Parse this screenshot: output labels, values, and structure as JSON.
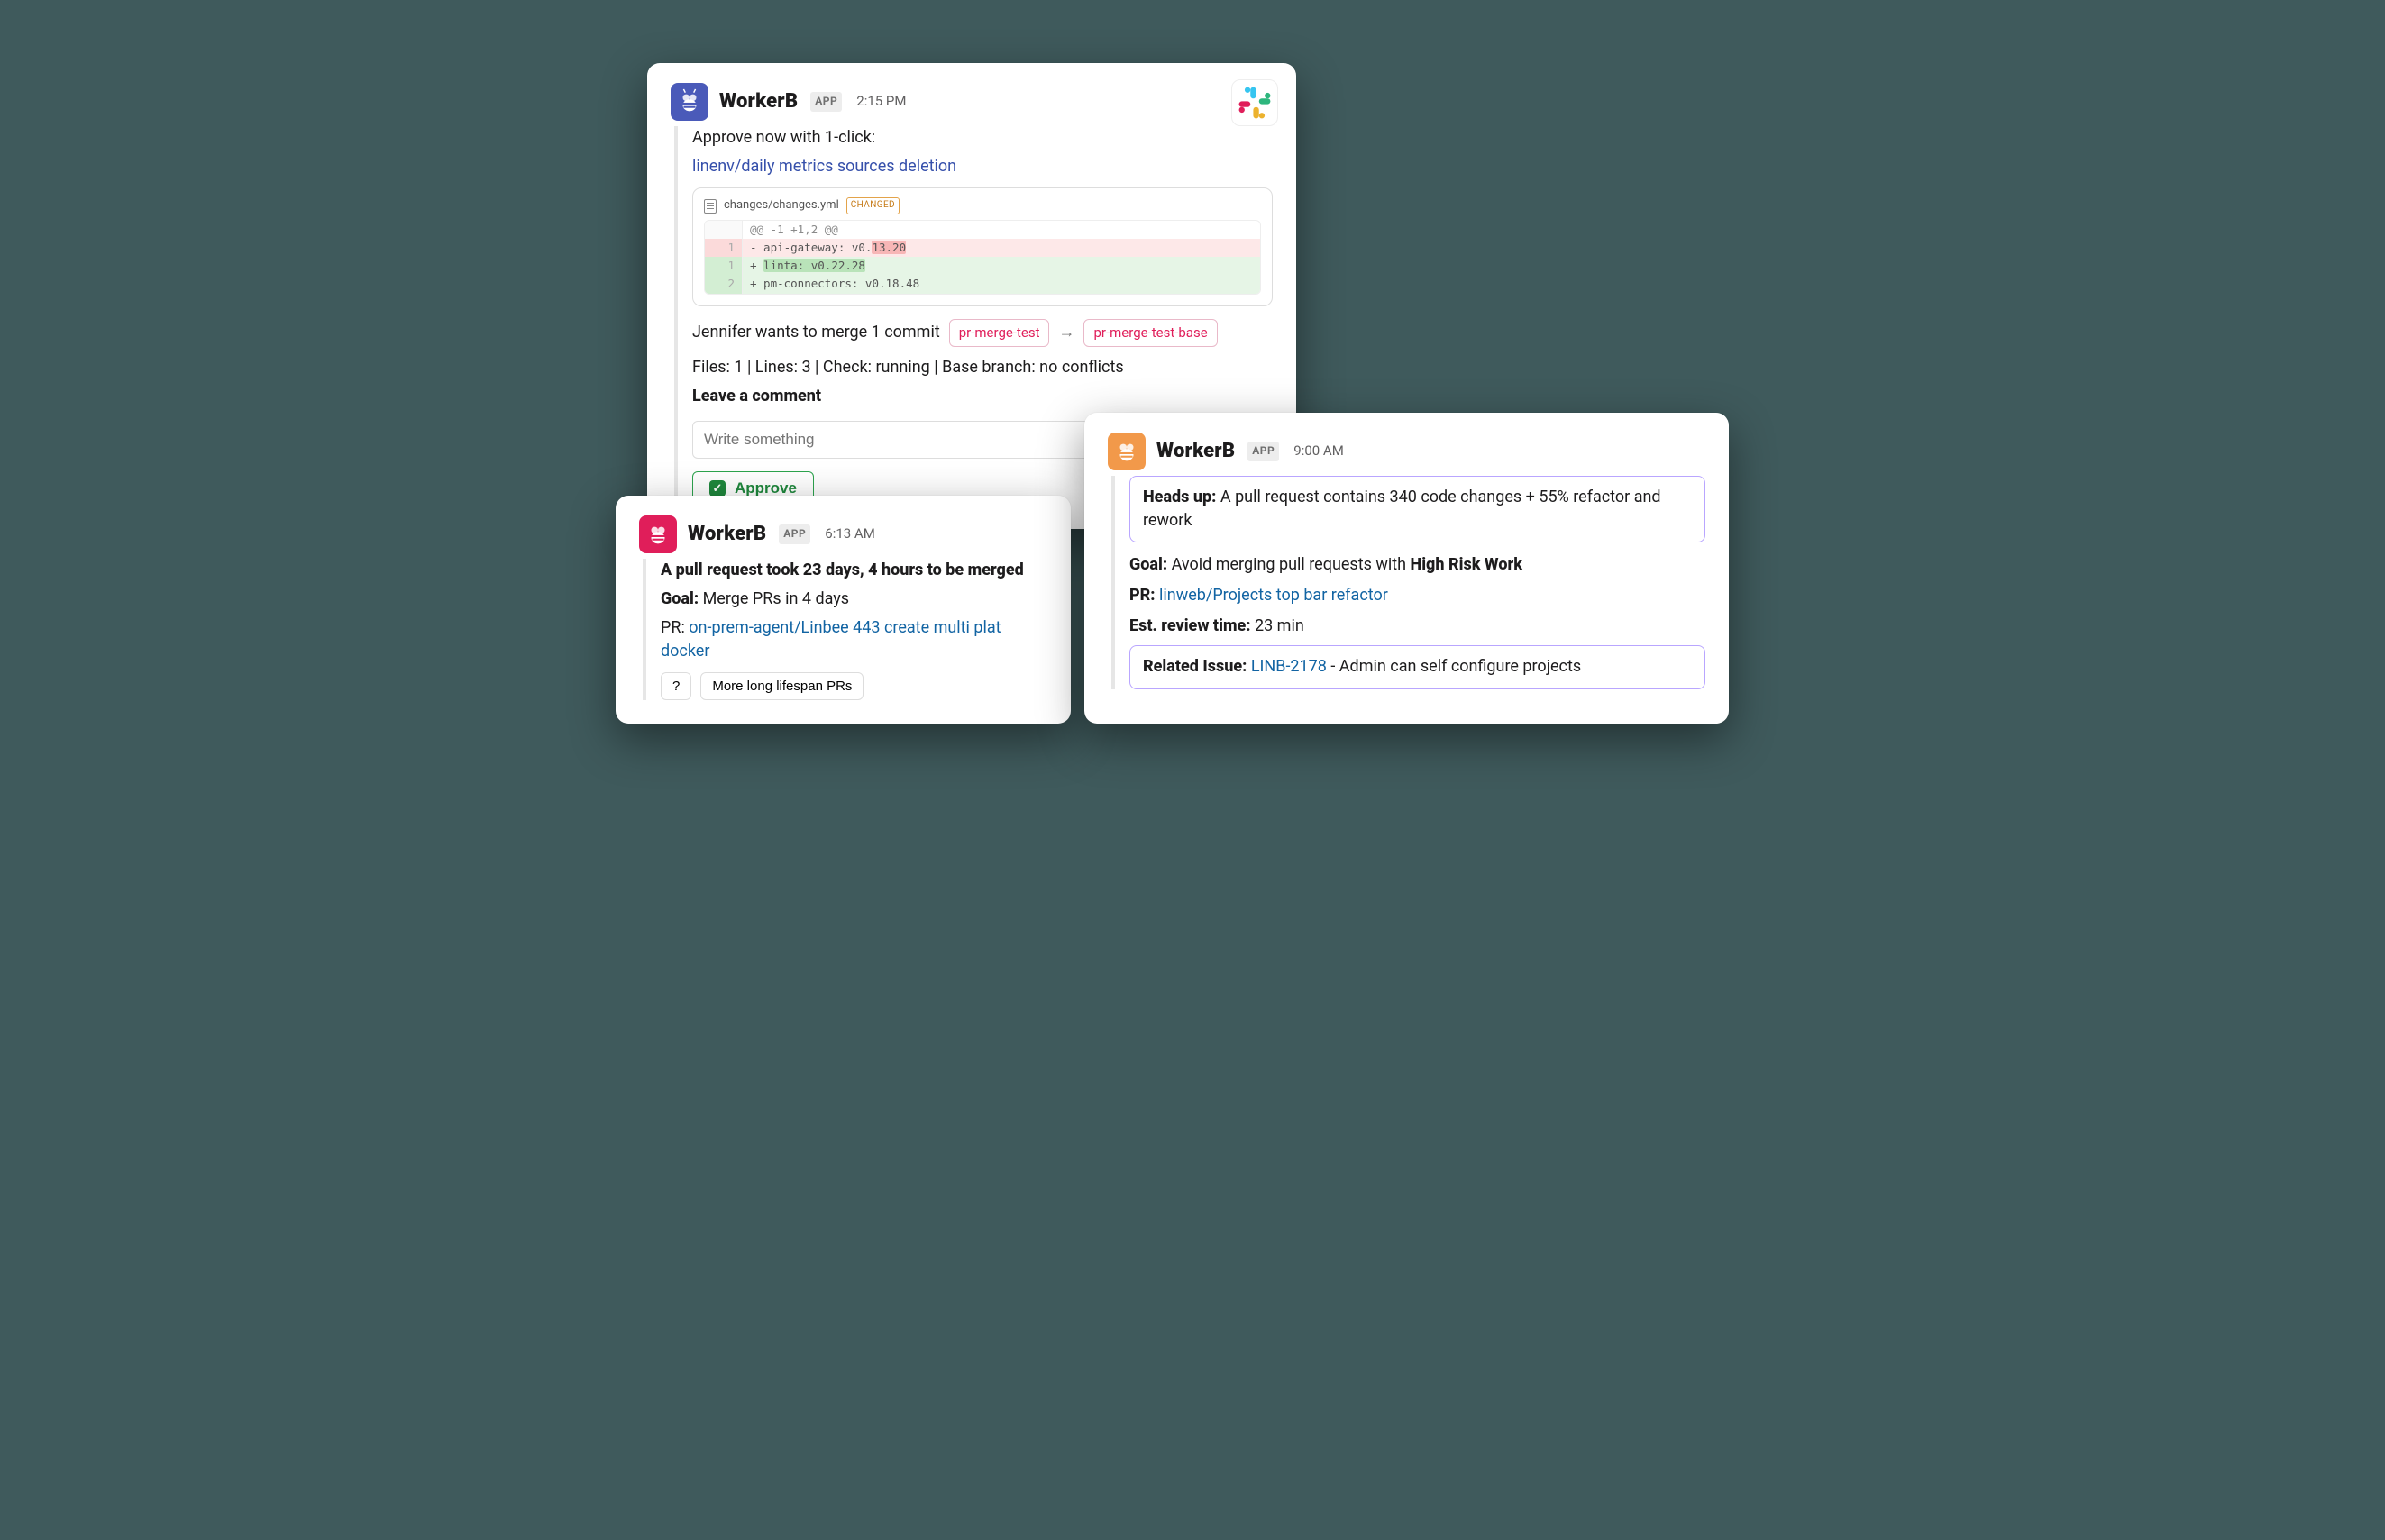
{
  "card1": {
    "app": "WorkerB",
    "badge": "APP",
    "time": "2:15 PM",
    "prompt": "Approve now with 1-click:",
    "title_link": "linenv/daily metrics sources deletion",
    "diff": {
      "filename": "changes/changes.yml",
      "changed": "CHANGED",
      "hunk": "@@ -1 +1,2 @@",
      "del_prefix": "- api-gateway: v0.",
      "del_hl": "13.20",
      "add1_prefix": "+ ",
      "add1_hl": "linta: v0.22.28",
      "add2": "+ pm-connectors: v0.18.48",
      "ln_del": "1",
      "ln_add1": "1",
      "ln_add2": "2"
    },
    "merge_prefix": "Jennifer wants to merge 1 commit",
    "branch_from": "pr-merge-test",
    "branch_to": "pr-merge-test-base",
    "stats": "Files: 1 | Lines: 3 | Check: running | Base branch: no conflicts",
    "leave": "Leave a comment",
    "placeholder": "Write something",
    "approve": "Approve"
  },
  "card2": {
    "app": "WorkerB",
    "badge": "APP",
    "time": "6:13 AM",
    "headline": "A pull request took 23 days, 4 hours to be merged",
    "goal_label": "Goal:",
    "goal": "Merge PRs in 4 days",
    "pr_label": "PR:",
    "pr_link": "on-prem-agent/Linbee 443 create multi plat docker",
    "btn_help": "?",
    "btn_more": "More long lifespan PRs"
  },
  "card3": {
    "app": "WorkerB",
    "badge": "APP",
    "time": "9:00 AM",
    "heads_label": "Heads up:",
    "heads_text": "A pull request contains 340 code changes + 55% refactor and rework",
    "goal_label": "Goal:",
    "goal_pre": "Avoid merging pull requests with ",
    "goal_bold": "High Risk Work",
    "pr_label": "PR:",
    "pr_link": "linweb/Projects top bar refactor",
    "est_label": "Est. review time:",
    "est_val": "23 min",
    "rel_label": "Related Issue:",
    "rel_link": "LINB-2178",
    "rel_tail": "  - Admin can self configure projects"
  }
}
